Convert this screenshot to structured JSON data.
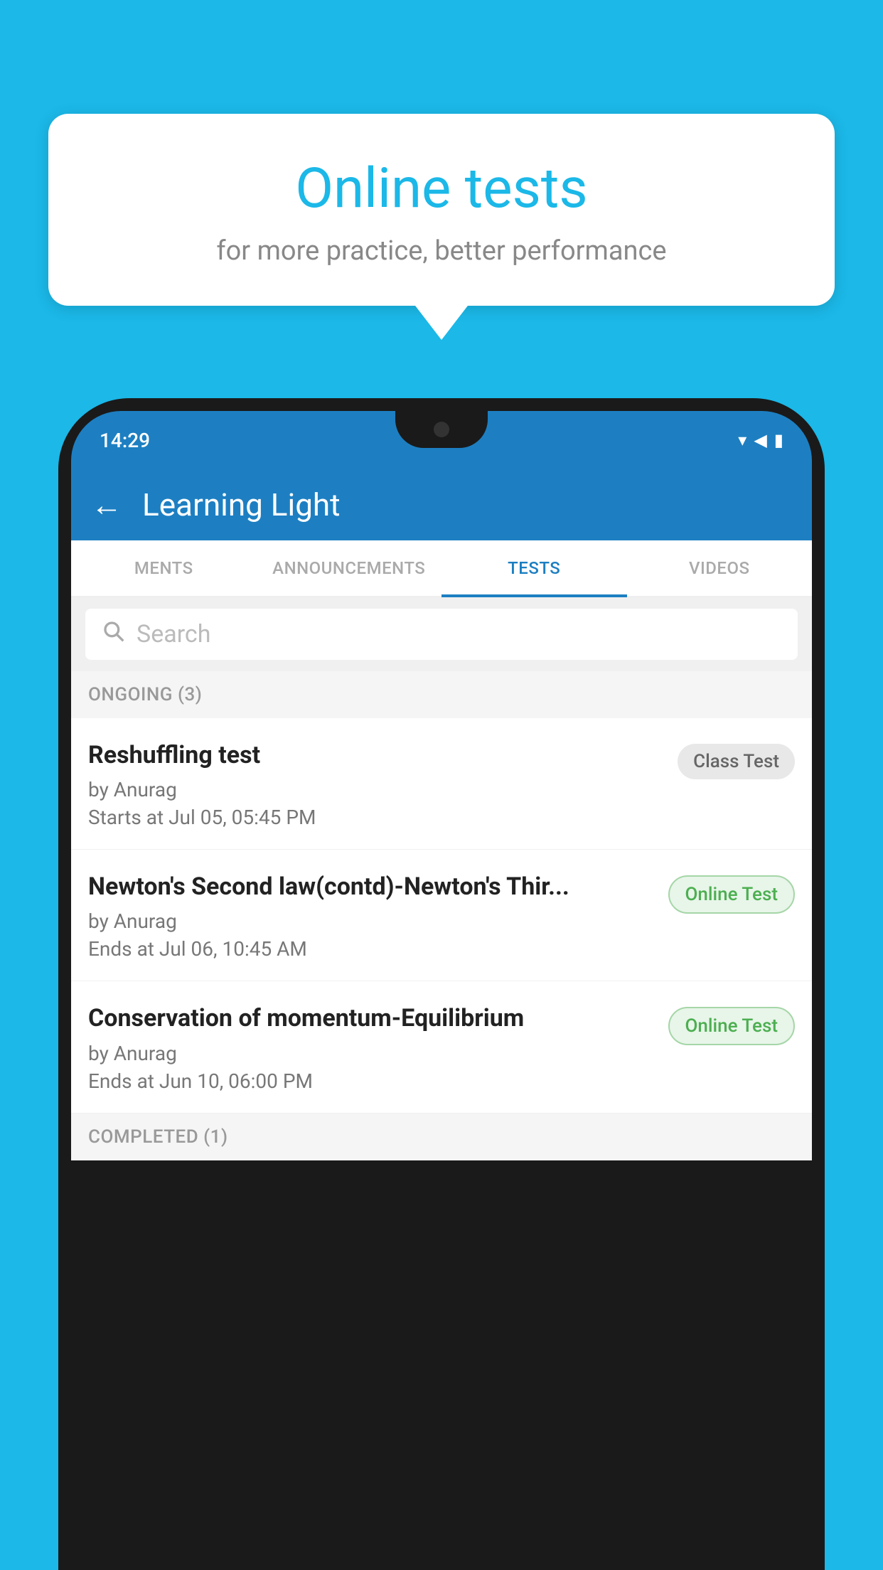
{
  "background_color": "#1bb8e8",
  "speech_bubble": {
    "title": "Online tests",
    "subtitle": "for more practice, better performance"
  },
  "phone": {
    "status_bar": {
      "time": "14:29",
      "icons": [
        "▾",
        "▲",
        "▮"
      ]
    },
    "app_bar": {
      "back_label": "←",
      "title": "Learning Light"
    },
    "tabs": [
      {
        "label": "MENTS",
        "active": false
      },
      {
        "label": "ANNOUNCEMENTS",
        "active": false
      },
      {
        "label": "TESTS",
        "active": true
      },
      {
        "label": "VIDEOS",
        "active": false
      }
    ],
    "search": {
      "placeholder": "Search"
    },
    "ongoing_section": {
      "label": "ONGOING (3)"
    },
    "test_items": [
      {
        "title": "Reshuffling test",
        "author": "by Anurag",
        "time_label": "Starts at",
        "time": "Jul 05, 05:45 PM",
        "badge": "Class Test",
        "badge_type": "class"
      },
      {
        "title": "Newton's Second law(contd)-Newton's Thir...",
        "author": "by Anurag",
        "time_label": "Ends at",
        "time": "Jul 06, 10:45 AM",
        "badge": "Online Test",
        "badge_type": "online"
      },
      {
        "title": "Conservation of momentum-Equilibrium",
        "author": "by Anurag",
        "time_label": "Ends at",
        "time": "Jun 10, 06:00 PM",
        "badge": "Online Test",
        "badge_type": "online"
      }
    ],
    "completed_section": {
      "label": "COMPLETED (1)"
    }
  }
}
